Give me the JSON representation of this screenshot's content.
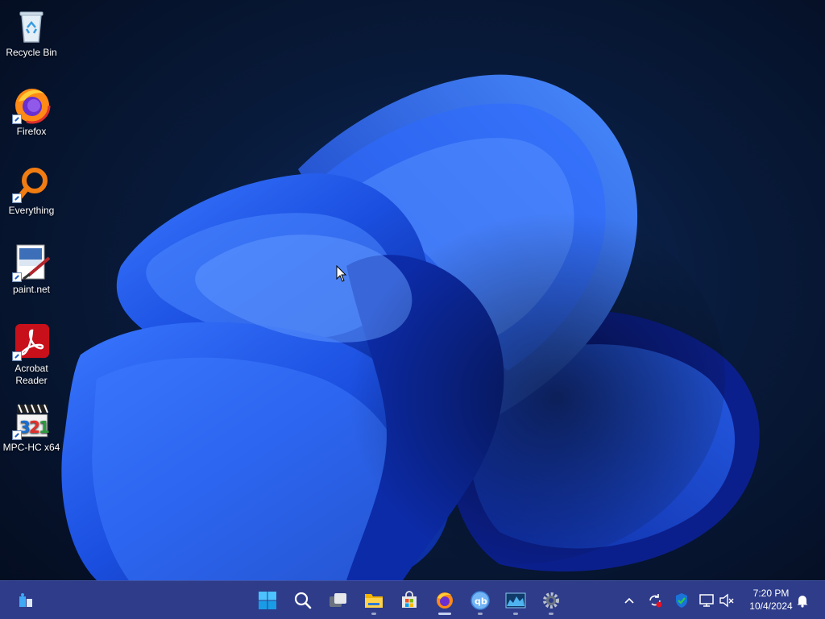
{
  "desktop": {
    "icons": [
      {
        "label": "Recycle Bin",
        "icon": "recycle-bin-icon"
      },
      {
        "label": "Firefox",
        "icon": "firefox-icon"
      },
      {
        "label": "Everything",
        "icon": "everything-search-icon"
      },
      {
        "label": "paint.net",
        "icon": "paintnet-icon"
      },
      {
        "label": "Acrobat Reader",
        "icon": "acrobat-reader-icon"
      },
      {
        "label": "MPC-HC x64",
        "icon": "mpc-hc-icon"
      }
    ]
  },
  "taskbar": {
    "pinned": [
      {
        "name": "start",
        "icon": "windows-start-icon"
      },
      {
        "name": "search",
        "icon": "search-icon"
      },
      {
        "name": "task-view",
        "icon": "task-view-icon"
      },
      {
        "name": "file-explorer",
        "icon": "folder-icon"
      },
      {
        "name": "microsoft-store",
        "icon": "store-icon"
      },
      {
        "name": "firefox",
        "icon": "firefox-icon"
      },
      {
        "name": "qbittorrent",
        "icon": "qbittorrent-icon"
      },
      {
        "name": "resource-monitor",
        "icon": "monitor-icon"
      },
      {
        "name": "settings",
        "icon": "gear-icon"
      }
    ],
    "clock": {
      "time": "7:20 PM",
      "date": "10/4/2024"
    }
  },
  "colors": {
    "taskbar": "#2e3c8a",
    "wallpaper_accent": "#1e50e6"
  }
}
